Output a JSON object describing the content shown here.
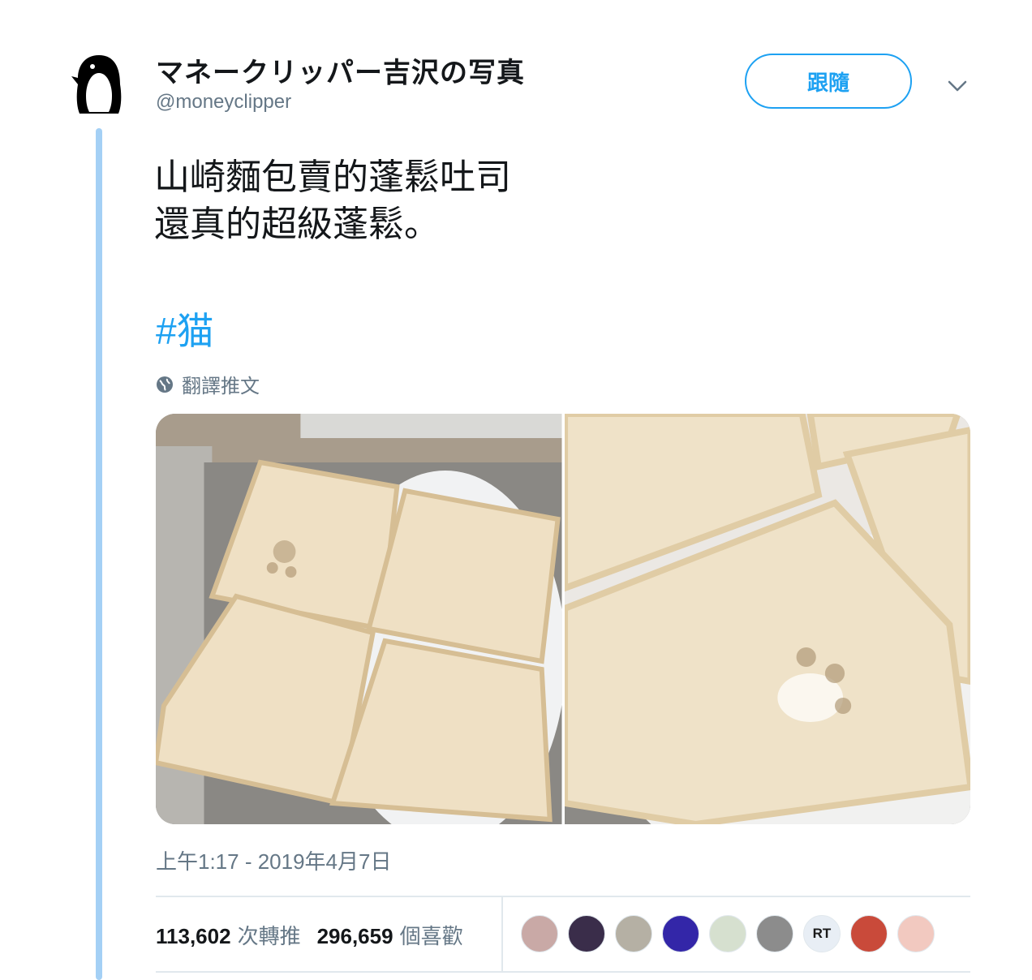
{
  "user": {
    "display_name": "マネークリッパー吉沢の写真",
    "handle": "@moneyclipper"
  },
  "follow_label": "跟隨",
  "tweet": {
    "text": "山崎麵包賣的蓬鬆吐司\n還真的超級蓬鬆。",
    "hashtag": "#猫",
    "translate_label": "翻譯推文",
    "timestamp": "上午1:17 - 2019年4月7日"
  },
  "stats": {
    "retweets": "113,602",
    "retweets_label": "次轉推",
    "likes": "296,659",
    "likes_label": "個喜歡"
  },
  "likers": [
    {
      "name": "liker-avatar-1",
      "color": "#c9a9a6"
    },
    {
      "name": "liker-avatar-2",
      "color": "#3a2d4a"
    },
    {
      "name": "liker-avatar-3",
      "color": "#b5b0a4"
    },
    {
      "name": "liker-avatar-4",
      "color": "#3326a8"
    },
    {
      "name": "liker-avatar-5",
      "color": "#d6e0cf"
    },
    {
      "name": "liker-avatar-6",
      "color": "#8c8c8c"
    },
    {
      "name": "liker-avatar-7",
      "color": "#e8eef5",
      "text": "RT"
    },
    {
      "name": "liker-avatar-8",
      "color": "#c94a3a"
    },
    {
      "name": "liker-avatar-9",
      "color": "#f2c9c0"
    }
  ],
  "colors": {
    "accent": "#1da1f2",
    "thread_line": "#a4d0f5",
    "muted": "#657786"
  }
}
